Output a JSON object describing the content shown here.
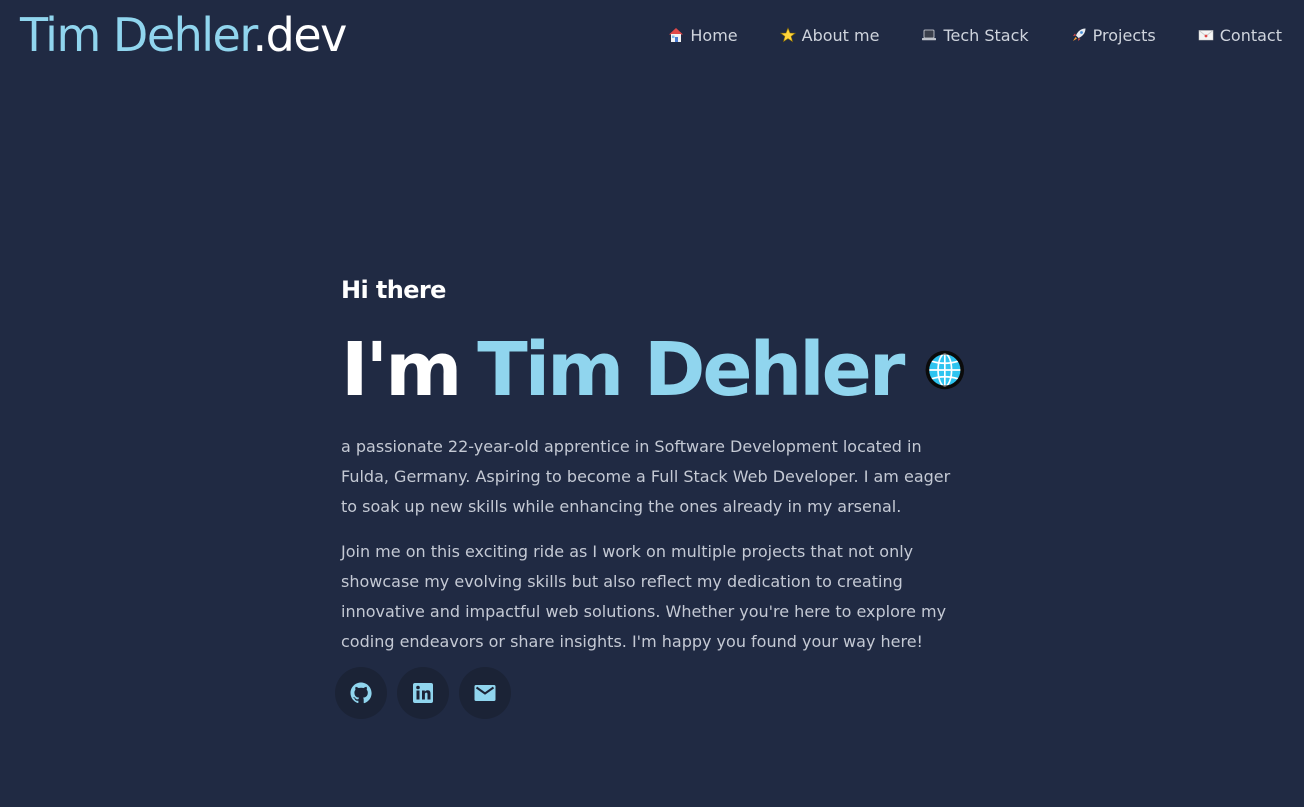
{
  "header": {
    "brand_name": "Tim Dehler",
    "brand_tld": ".dev",
    "nav": [
      {
        "label": "Home",
        "icon": "house-icon"
      },
      {
        "label": "About me",
        "icon": "star-icon"
      },
      {
        "label": "Tech Stack",
        "icon": "laptop-icon"
      },
      {
        "label": "Projects",
        "icon": "rocket-icon"
      },
      {
        "label": "Contact",
        "icon": "envelope-icon"
      }
    ]
  },
  "hero": {
    "greeting": "Hi there",
    "headline_prefix": "I'm",
    "headline_name": "Tim Dehler",
    "headline_icon": "globe-icon",
    "bio": [
      "a passionate 22-year-old apprentice in Software Development located in Fulda, Germany. Aspiring to become a Full Stack Web Developer. I am eager to soak up new skills while enhancing the ones already in my arsenal.",
      "Join me on this exciting ride as I work on multiple projects that not only showcase my evolving skills but also reflect my dedication to creating innovative and impactful web solutions. Whether you're here to explore my coding endeavors or share insights. I'm happy you found your way here!"
    ],
    "socials": [
      {
        "icon": "github-icon"
      },
      {
        "icon": "linkedin-icon"
      },
      {
        "icon": "mail-icon"
      }
    ]
  },
  "colors": {
    "background": "#202a43",
    "accent": "#90d5ee",
    "text": "#c4c9d4",
    "social_bg": "#1b2336"
  }
}
